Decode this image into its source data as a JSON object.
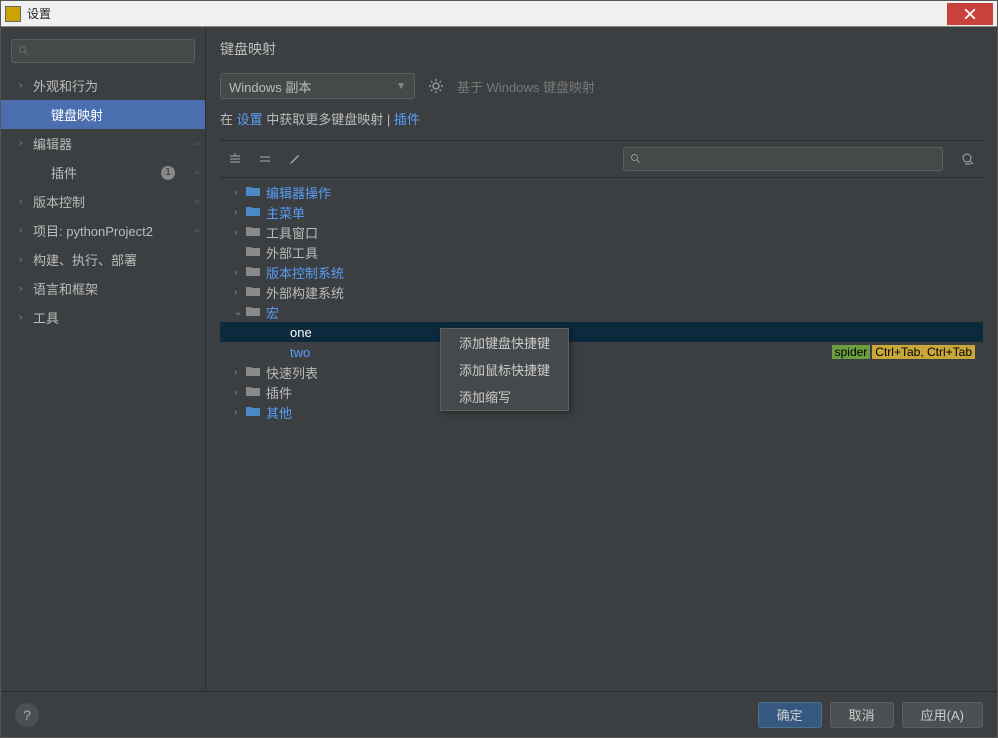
{
  "window": {
    "title": "设置"
  },
  "sidebar": {
    "items": [
      {
        "label": "外观和行为",
        "level": 0,
        "chevron": true
      },
      {
        "label": "键盘映射",
        "level": 1,
        "selected": true
      },
      {
        "label": "编辑器",
        "level": 0,
        "chevron": true,
        "boxed": true
      },
      {
        "label": "插件",
        "level": 1,
        "badge": "1",
        "iconsRight": true
      },
      {
        "label": "版本控制",
        "level": 0,
        "chevron": true,
        "boxed": true
      },
      {
        "label": "项目: pythonProject2",
        "level": 0,
        "chevron": true,
        "boxed": true
      },
      {
        "label": "构建、执行、部署",
        "level": 0,
        "chevron": true
      },
      {
        "label": "语言和框架",
        "level": 0,
        "chevron": true
      },
      {
        "label": "工具",
        "level": 0,
        "chevron": true
      }
    ]
  },
  "main": {
    "title": "键盘映射",
    "dropdown": "Windows 副本",
    "hint": "基于 Windows 键盘映射",
    "linkrow": {
      "pre": "在 ",
      "link1": "设置",
      "mid": " 中获取更多键盘映射 | ",
      "link2": "插件"
    },
    "search_placeholder": ""
  },
  "tree": {
    "items": [
      {
        "label": "编辑器操作",
        "link": true,
        "depth": 1,
        "chevron": ">",
        "icon": "folder-blue"
      },
      {
        "label": "主菜单",
        "link": true,
        "depth": 1,
        "chevron": ">",
        "icon": "folder-blue"
      },
      {
        "label": "工具窗口",
        "link": false,
        "depth": 1,
        "chevron": ">",
        "icon": "folder"
      },
      {
        "label": "外部工具",
        "link": false,
        "depth": 1,
        "chevron": "",
        "icon": "folder"
      },
      {
        "label": "版本控制系统",
        "link": true,
        "depth": 1,
        "chevron": ">",
        "icon": "folder"
      },
      {
        "label": "外部构建系统",
        "link": false,
        "depth": 1,
        "chevron": ">",
        "icon": "folder-gear"
      },
      {
        "label": "宏",
        "link": true,
        "depth": 1,
        "chevron": "v",
        "icon": "folder"
      },
      {
        "label": "one",
        "link": false,
        "depth": 2,
        "selected": true
      },
      {
        "label": "two",
        "link": true,
        "depth": 2,
        "tags": {
          "green": "spider",
          "yellow": "Ctrl+Tab, Ctrl+Tab"
        }
      },
      {
        "label": "快速列表",
        "link": false,
        "depth": 1,
        "chevron": ">",
        "icon": "folder"
      },
      {
        "label": "插件",
        "link": false,
        "depth": 1,
        "chevron": ">",
        "icon": "folder"
      },
      {
        "label": "其他",
        "link": true,
        "depth": 1,
        "chevron": ">",
        "icon": "folder-blue"
      }
    ]
  },
  "context_menu": {
    "items": [
      "添加键盘快捷键",
      "添加鼠标快捷键",
      "添加缩写"
    ]
  },
  "footer": {
    "ok": "确定",
    "cancel": "取消",
    "apply": "应用(A)"
  }
}
